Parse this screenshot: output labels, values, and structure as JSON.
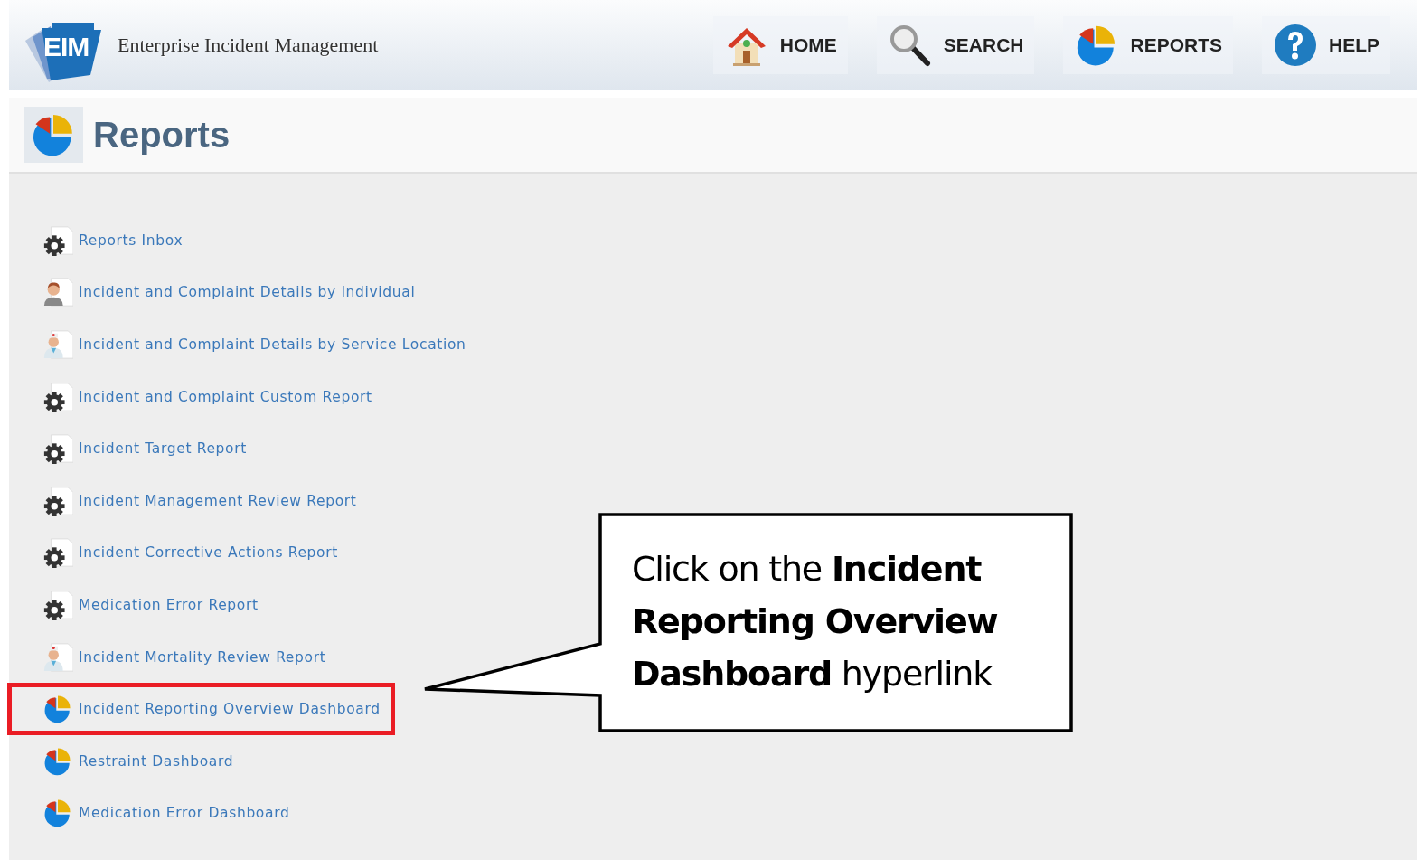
{
  "header": {
    "logo_text": "EIM",
    "app_title": "Enterprise Incident Management",
    "nav": [
      {
        "kind": "home",
        "label": "HOME"
      },
      {
        "kind": "search",
        "label": "SEARCH"
      },
      {
        "kind": "reports",
        "label": "REPORTS"
      },
      {
        "kind": "help",
        "label": "HELP"
      }
    ]
  },
  "page_title": "Reports",
  "reports": [
    {
      "kind": "gear",
      "label": "Reports Inbox",
      "highlighted": false
    },
    {
      "kind": "person",
      "label": "Incident and Complaint Details by Individual",
      "highlighted": false
    },
    {
      "kind": "doctor",
      "label": "Incident and Complaint Details by Service Location",
      "highlighted": false
    },
    {
      "kind": "gear",
      "label": "Incident and Complaint Custom Report",
      "highlighted": false
    },
    {
      "kind": "gear",
      "label": "Incident Target Report",
      "highlighted": false
    },
    {
      "kind": "gear",
      "label": "Incident Management Review Report",
      "highlighted": false
    },
    {
      "kind": "gear",
      "label": "Incident Corrective Actions Report",
      "highlighted": false
    },
    {
      "kind": "gear",
      "label": "Medication Error Report",
      "highlighted": false
    },
    {
      "kind": "doctor",
      "label": "Incident Mortality Review Report",
      "highlighted": false
    },
    {
      "kind": "pie",
      "label": "Incident Reporting Overview Dashboard",
      "highlighted": true
    },
    {
      "kind": "pie",
      "label": "Restraint Dashboard",
      "highlighted": false
    },
    {
      "kind": "pie",
      "label": "Medication Error Dashboard",
      "highlighted": false
    }
  ],
  "callout": {
    "text": "Click on the **Incident Reporting Overview Dashboard** hyperlink"
  }
}
